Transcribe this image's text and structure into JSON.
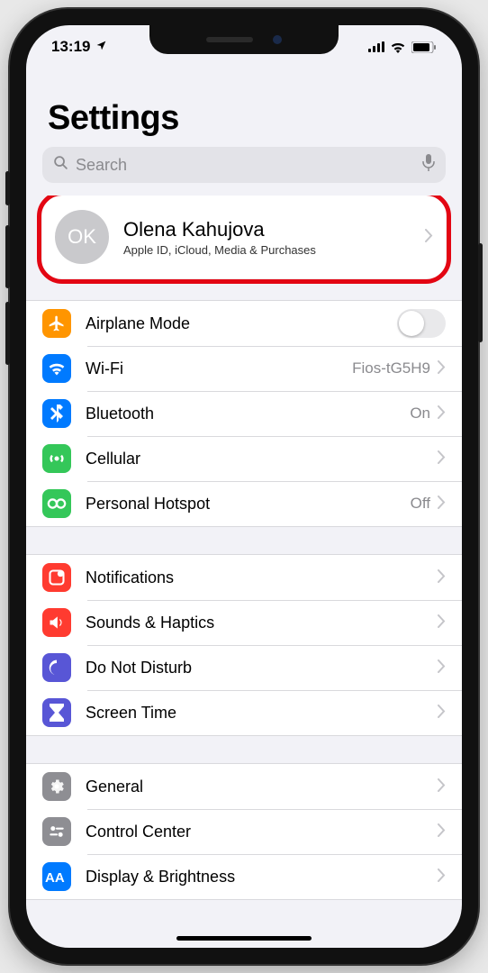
{
  "status": {
    "time": "13:19"
  },
  "header": {
    "title": "Settings"
  },
  "search": {
    "placeholder": "Search"
  },
  "profile": {
    "initials": "OK",
    "name": "Olena Kahujova",
    "subtitle": "Apple ID, iCloud, Media & Purchases"
  },
  "groups": [
    {
      "rows": [
        {
          "icon": "airplane-icon",
          "color": "bg-orange",
          "label": "Airplane Mode",
          "control": "toggle"
        },
        {
          "icon": "wifi-icon",
          "color": "bg-blue",
          "label": "Wi-Fi",
          "value": "Fios-tG5H9",
          "control": "disclosure"
        },
        {
          "icon": "bluetooth-icon",
          "color": "bg-blue",
          "label": "Bluetooth",
          "value": "On",
          "control": "disclosure"
        },
        {
          "icon": "cellular-icon",
          "color": "bg-green",
          "label": "Cellular",
          "control": "disclosure"
        },
        {
          "icon": "hotspot-icon",
          "color": "bg-green",
          "label": "Personal Hotspot",
          "value": "Off",
          "control": "disclosure"
        }
      ]
    },
    {
      "rows": [
        {
          "icon": "notifications-icon",
          "color": "bg-red",
          "label": "Notifications",
          "control": "disclosure"
        },
        {
          "icon": "sounds-icon",
          "color": "bg-red",
          "label": "Sounds & Haptics",
          "control": "disclosure"
        },
        {
          "icon": "dnd-icon",
          "color": "bg-purple",
          "label": "Do Not Disturb",
          "control": "disclosure"
        },
        {
          "icon": "screentime-icon",
          "color": "bg-purple",
          "label": "Screen Time",
          "control": "disclosure"
        }
      ]
    },
    {
      "rows": [
        {
          "icon": "general-icon",
          "color": "bg-gray",
          "label": "General",
          "control": "disclosure"
        },
        {
          "icon": "controlcenter-icon",
          "color": "bg-gray",
          "label": "Control Center",
          "control": "disclosure"
        },
        {
          "icon": "display-icon",
          "color": "bg-blue",
          "label": "Display & Brightness",
          "control": "disclosure"
        }
      ]
    }
  ]
}
